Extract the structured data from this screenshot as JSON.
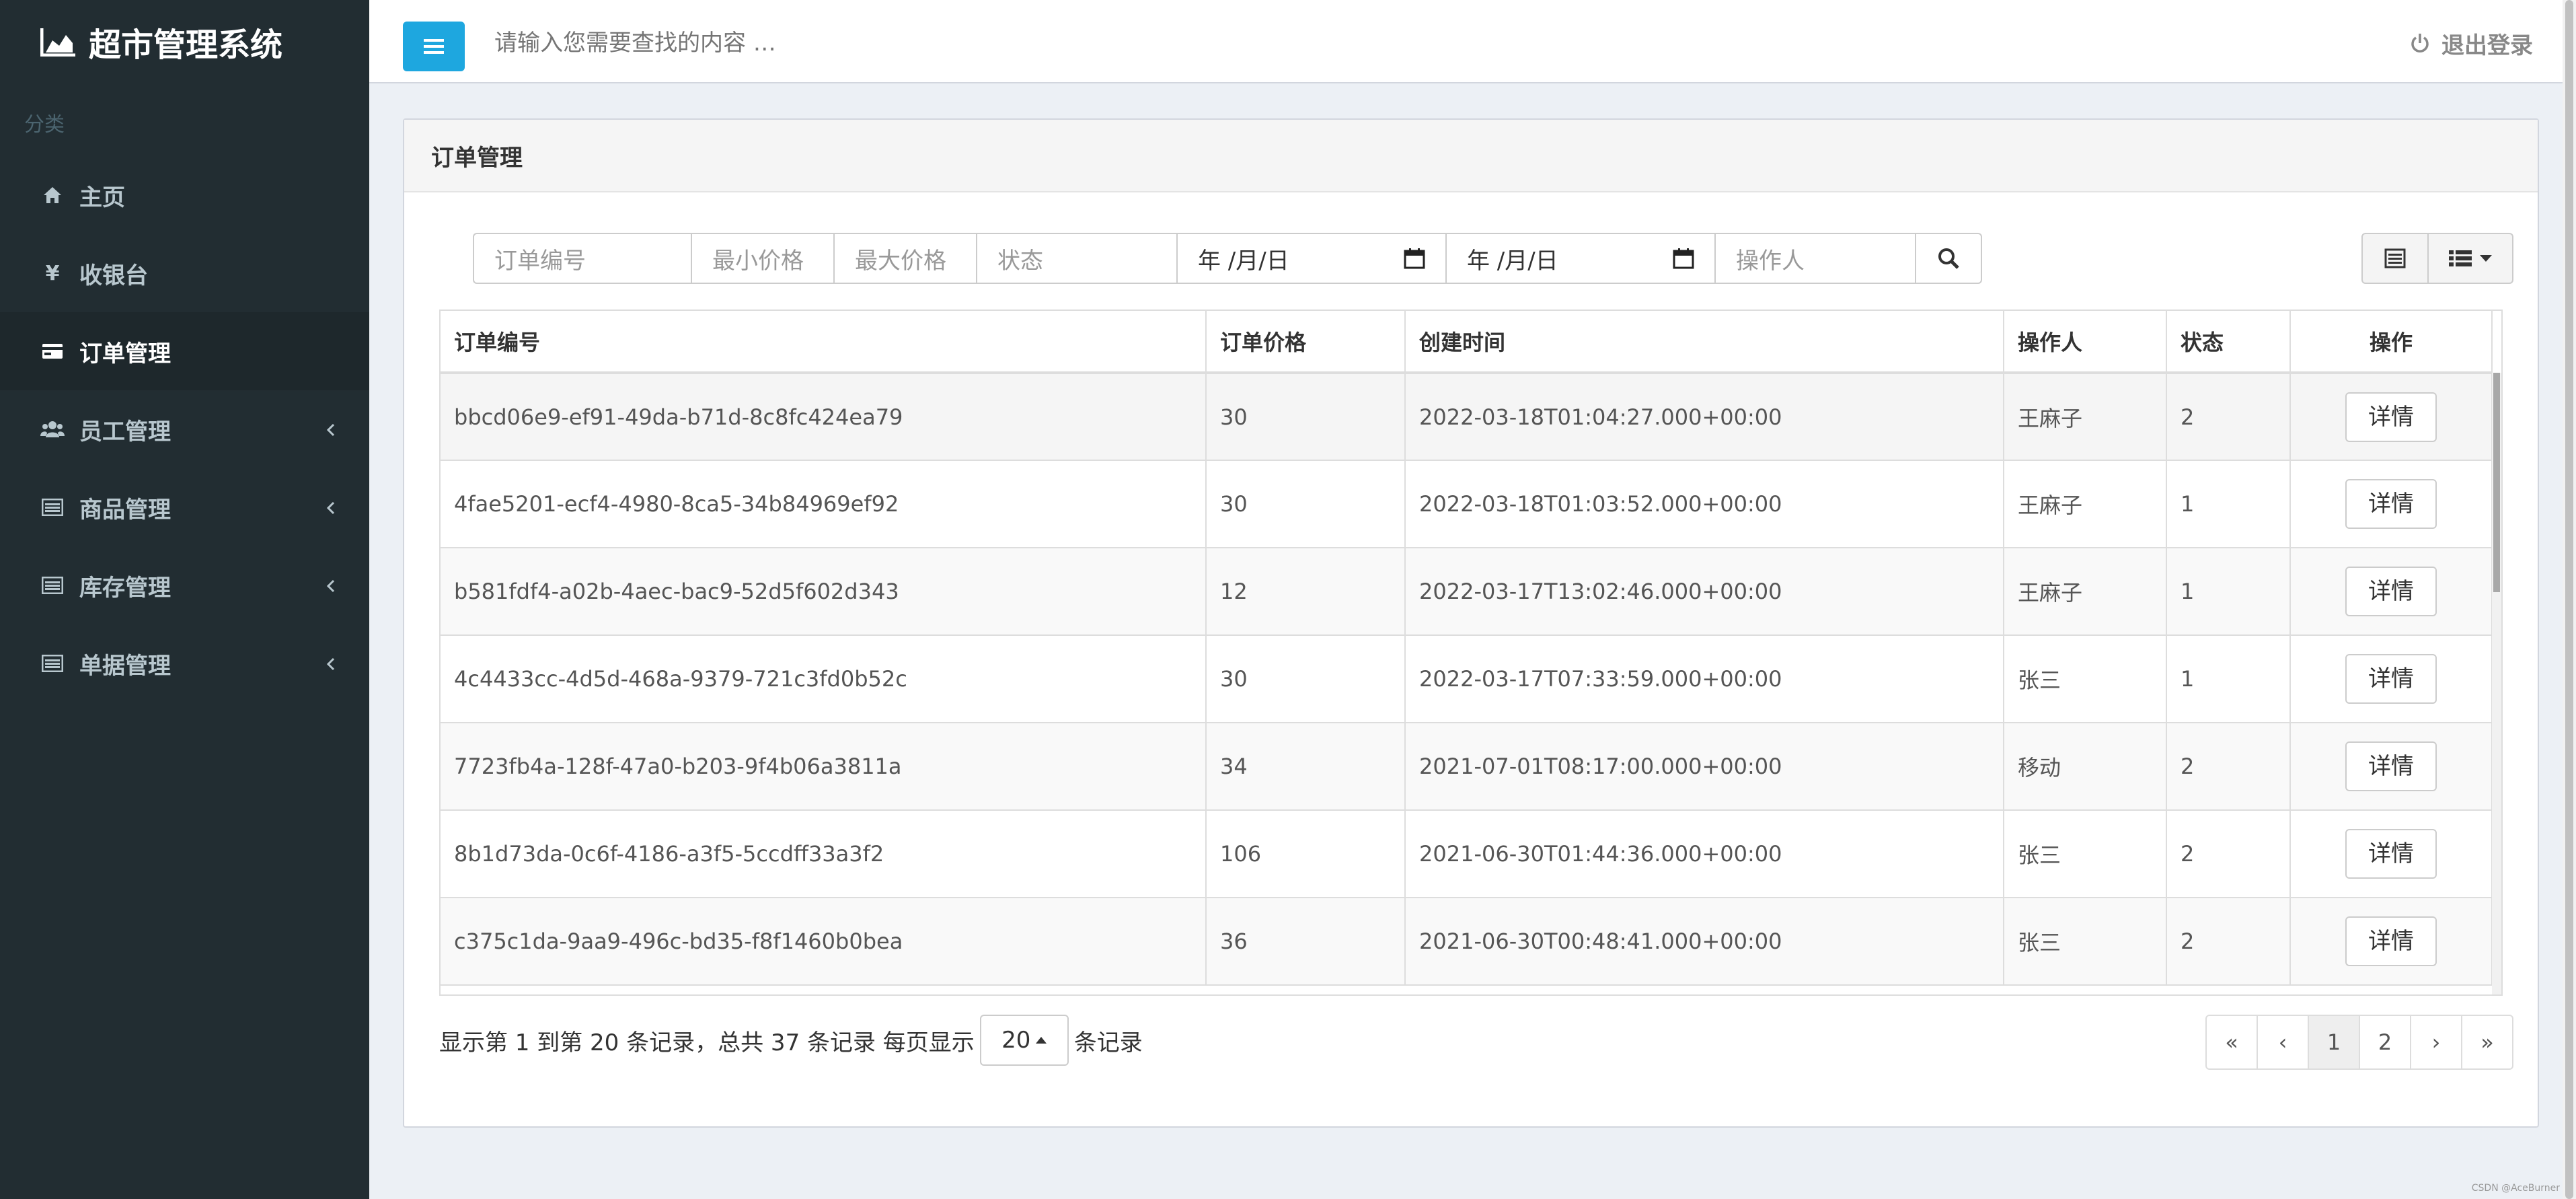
{
  "sidebar": {
    "brand": "超市管理系统",
    "category": "分类",
    "items": [
      {
        "label": "主页",
        "icon": "home-icon",
        "has_children": false
      },
      {
        "label": "收银台",
        "icon": "yen-icon",
        "has_children": false
      },
      {
        "label": "订单管理",
        "icon": "credit-card-icon",
        "has_children": false,
        "active": true
      },
      {
        "label": "员工管理",
        "icon": "users-icon",
        "has_children": true
      },
      {
        "label": "商品管理",
        "icon": "list-alt-icon",
        "has_children": true
      },
      {
        "label": "库存管理",
        "icon": "list-alt-icon",
        "has_children": true
      },
      {
        "label": "单据管理",
        "icon": "list-alt-icon",
        "has_children": true
      }
    ]
  },
  "header": {
    "search_placeholder": "请输入您需要查找的内容 …",
    "logout_label": "退出登录"
  },
  "panel": {
    "title": "订单管理"
  },
  "filters": {
    "order_no": "订单编号",
    "min_price": "最小价格",
    "max_price": "最大价格",
    "status": "状态",
    "date_start": "年 /月/日",
    "date_end": "年 /月/日",
    "operator": "操作人"
  },
  "table": {
    "headers": [
      "订单编号",
      "订单价格",
      "创建时间",
      "操作人",
      "状态",
      "操作"
    ],
    "detail_label": "详情",
    "rows": [
      {
        "id": "bbcd06e9-ef91-49da-b71d-8c8fc424ea79",
        "price": "30",
        "time": "2022-03-18T01:04:27.000+00:00",
        "operator": "王麻子",
        "status": "2"
      },
      {
        "id": "4fae5201-ecf4-4980-8ca5-34b84969ef92",
        "price": "30",
        "time": "2022-03-18T01:03:52.000+00:00",
        "operator": "王麻子",
        "status": "1"
      },
      {
        "id": "b581fdf4-a02b-4aec-bac9-52d5f602d343",
        "price": "12",
        "time": "2022-03-17T13:02:46.000+00:00",
        "operator": "王麻子",
        "status": "1"
      },
      {
        "id": "4c4433cc-4d5d-468a-9379-721c3fd0b52c",
        "price": "30",
        "time": "2022-03-17T07:33:59.000+00:00",
        "operator": "张三",
        "status": "1"
      },
      {
        "id": "7723fb4a-128f-47a0-b203-9f4b06a3811a",
        "price": "34",
        "time": "2021-07-01T08:17:00.000+00:00",
        "operator": "移动",
        "status": "2"
      },
      {
        "id": "8b1d73da-0c6f-4186-a3f5-5ccdff33a3f2",
        "price": "106",
        "time": "2021-06-30T01:44:36.000+00:00",
        "operator": "张三",
        "status": "2"
      },
      {
        "id": "c375c1da-9aa9-496c-bd35-f8f1460b0bea",
        "price": "36",
        "time": "2021-06-30T00:48:41.000+00:00",
        "operator": "张三",
        "status": "2"
      }
    ]
  },
  "footer": {
    "info_prefix": "显示第 1 到第 20 条记录，总共 37 条记录 每页显示",
    "page_size": "20",
    "info_suffix": "条记录",
    "pages": [
      "«",
      "‹",
      "1",
      "2",
      "›",
      "»"
    ],
    "current_page": "1"
  },
  "watermark": "CSDN @AceBurner",
  "colors": {
    "sidebar_bg": "#222d32",
    "sidebar_active": "#1e282c",
    "toggle_button": "#1ea7df",
    "content_bg": "#ecf0f5"
  }
}
